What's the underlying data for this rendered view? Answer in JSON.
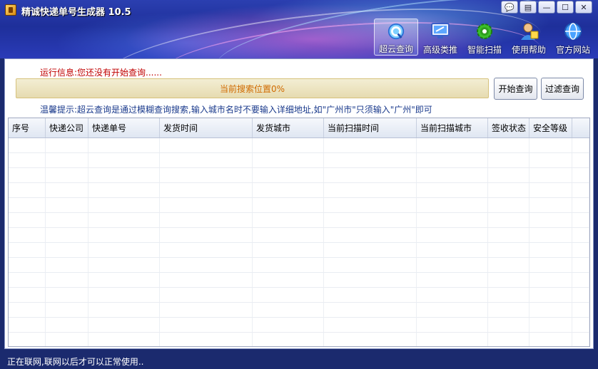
{
  "window": {
    "title": "精诚快递单号生成器 10.5",
    "controls": [
      "💬",
      "▤",
      "—",
      "☐",
      "✕"
    ]
  },
  "toolbar": {
    "items": [
      {
        "label": "超云查询",
        "icon": "cloud-search-icon",
        "active": true
      },
      {
        "label": "高级类推",
        "icon": "monitor-icon",
        "active": false
      },
      {
        "label": "智能扫描",
        "icon": "gear-icon",
        "active": false
      },
      {
        "label": "使用帮助",
        "icon": "help-user-icon",
        "active": false
      },
      {
        "label": "官方网站",
        "icon": "globe-icon",
        "active": false
      }
    ]
  },
  "status": {
    "run_info_label": "运行信息:",
    "run_info_value": "您还没有开始查询......",
    "progress_text": "当前搜索位置0%",
    "progress_value": 0,
    "tip": "温馨提示:超云查询是通过模糊查询搜索,输入城市名时不要输入详细地址,如\"广州市\"只须输入\"广州\"即可"
  },
  "buttons": {
    "start_query": "开始查询",
    "filter_query": "过滤查询"
  },
  "table": {
    "columns": [
      "序号",
      "快递公司",
      "快递单号",
      "发货时间",
      "发货城市",
      "当前扫描时间",
      "当前扫描城市",
      "签收状态",
      "安全等级"
    ],
    "rows": []
  },
  "statusbar": {
    "text": "正在联网,联网以后才可以正常使用.."
  },
  "colors": {
    "title_bar": "#1e2f9a",
    "run_info": "#c00000",
    "tip": "#1a3a8c",
    "progress_text": "#d06a00",
    "statusbar": "#1b2a6e"
  }
}
